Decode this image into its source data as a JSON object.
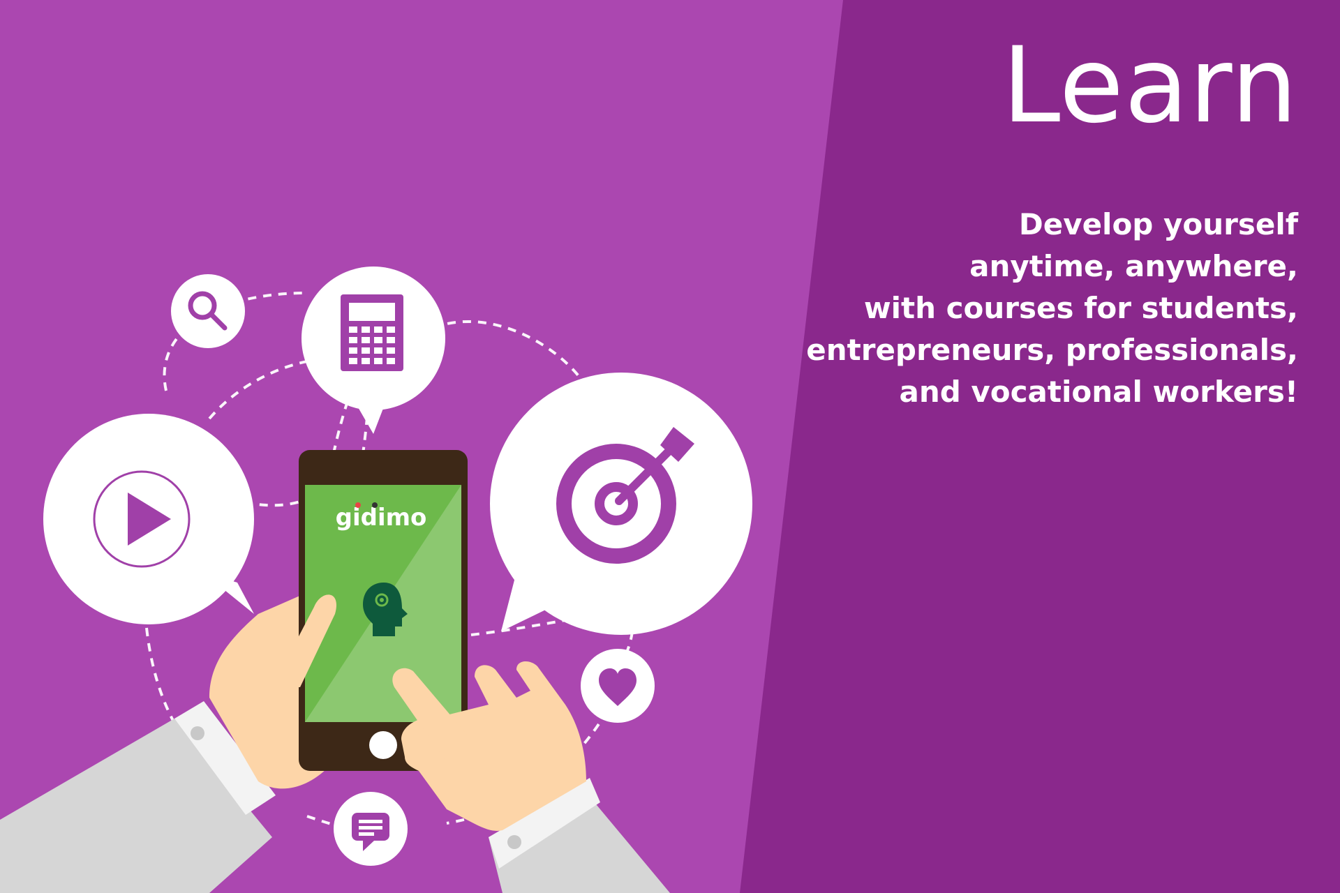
{
  "colors": {
    "left_panel": "#ab47b0",
    "right_panel": "#8a288c",
    "icon_purple": "#a040a8",
    "phone_body": "#3d2817",
    "screen_green": "#6db94b",
    "screen_green_light": "#8cc870",
    "head_green": "#0e5a3c",
    "skin": "#fdd5a8",
    "sleeve": "#d6d6d6",
    "cuff": "#f3f3f3"
  },
  "hero": {
    "headline": "Learn",
    "tagline_lines": [
      "Develop yourself",
      "anytime, anywhere,",
      "with courses for students,",
      "entrepreneurs, professionals,",
      "and vocational workers!"
    ]
  },
  "phone": {
    "brand": "gidimo"
  },
  "icons": [
    "search-icon",
    "calculator-icon",
    "play-icon",
    "target-icon",
    "heart-icon",
    "message-icon",
    "brain-gear-icon"
  ]
}
